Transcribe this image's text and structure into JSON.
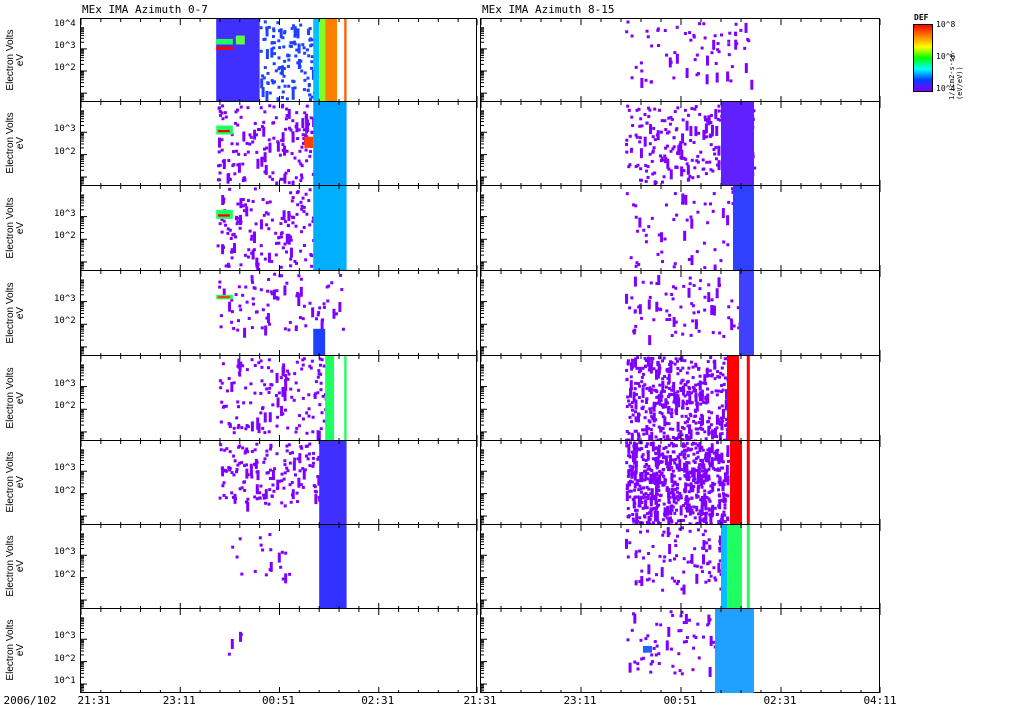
{
  "chart_data": {
    "type": "heatmap",
    "titles": [
      "MEx IMA Azimuth 0-7",
      "MEx IMA Azimuth 8-15"
    ],
    "date_label": "2006/102",
    "xticks": [
      "21:31",
      "23:11",
      "00:51",
      "02:31",
      "04:11"
    ],
    "xrange_hours": [
      0,
      6.667
    ],
    "ylabel": "Electron Volts",
    "yunit": "eV",
    "yrange_log10": [
      0.6,
      4.35
    ],
    "colorbar": {
      "label": "DEF",
      "unit": "1/(cm2-s-sr-(eV/eV))",
      "ticks": [
        "10^8",
        "10^6",
        "10^4"
      ]
    },
    "panels": [
      {
        "yticks": [
          "10^4",
          "10^3",
          "10^2"
        ],
        "left": [
          {
            "k": "fill",
            "t": [
              2.27,
              3.0
            ],
            "e": [
              0.6,
              4.35
            ],
            "c": "#4030ff"
          },
          {
            "k": "fill",
            "t": [
              2.27,
              2.55
            ],
            "e": [
              3.2,
              3.45
            ],
            "c": "#20ff60"
          },
          {
            "k": "fill",
            "t": [
              2.27,
              2.55
            ],
            "e": [
              2.95,
              3.1
            ],
            "c": "#ff0000"
          },
          {
            "k": "fill",
            "t": [
              2.6,
              2.75
            ],
            "e": [
              3.2,
              3.6
            ],
            "c": "#60ff40"
          },
          {
            "k": "dots",
            "t": [
              3.0,
              3.9
            ],
            "e": [
              0.8,
              4.3
            ],
            "n": 120,
            "c": "#2040ff"
          },
          {
            "k": "fill",
            "t": [
              3.9,
              4.0
            ],
            "e": [
              0.6,
              4.35
            ],
            "c": "#00c0ff"
          },
          {
            "k": "fill",
            "t": [
              4.0,
              4.1
            ],
            "e": [
              0.6,
              4.35
            ],
            "c": "#80ff20"
          },
          {
            "k": "fill",
            "t": [
              4.1,
              4.3
            ],
            "e": [
              0.6,
              4.35
            ],
            "c": "#ff8000"
          },
          {
            "k": "fill",
            "t": [
              4.42,
              4.46
            ],
            "e": [
              0.6,
              4.35
            ],
            "c": "#ff6000"
          }
        ],
        "right": [
          {
            "k": "dots",
            "t": [
              2.4,
              4.5
            ],
            "e": [
              1.5,
              4.3
            ],
            "n": 70,
            "c": "#7f00ff"
          }
        ]
      },
      {
        "yticks": [
          "10^3",
          "10^2"
        ],
        "left": [
          {
            "k": "dots",
            "t": [
              2.27,
              4.4
            ],
            "e": [
              0.8,
              4.3
            ],
            "n": 220,
            "c": "#7f00ff"
          },
          {
            "k": "fill",
            "t": [
              2.27,
              2.55
            ],
            "e": [
              2.9,
              3.3
            ],
            "c": "#20ff60"
          },
          {
            "k": "fill",
            "t": [
              2.3,
              2.5
            ],
            "e": [
              3.0,
              3.1
            ],
            "c": "#ff0000"
          },
          {
            "k": "fill",
            "t": [
              3.75,
              3.9
            ],
            "e": [
              2.3,
              2.8
            ],
            "c": "#ff4000"
          },
          {
            "k": "fill",
            "t": [
              3.9,
              4.46
            ],
            "e": [
              0.6,
              4.35
            ],
            "c": "#00a0ff"
          }
        ],
        "right": [
          {
            "k": "dots",
            "t": [
              2.4,
              4.55
            ],
            "e": [
              0.8,
              4.3
            ],
            "n": 260,
            "c": "#7f00ff"
          },
          {
            "k": "fill",
            "t": [
              4.0,
              4.55
            ],
            "e": [
              0.6,
              4.35
            ],
            "c": "#6020ff"
          }
        ]
      },
      {
        "yticks": [
          "10^3",
          "10^2"
        ],
        "left": [
          {
            "k": "dots",
            "t": [
              2.27,
              4.4
            ],
            "e": [
              0.8,
              4.3
            ],
            "n": 180,
            "c": "#7f00ff"
          },
          {
            "k": "fill",
            "t": [
              2.27,
              2.55
            ],
            "e": [
              2.9,
              3.3
            ],
            "c": "#20ff60"
          },
          {
            "k": "fill",
            "t": [
              2.3,
              2.5
            ],
            "e": [
              3.0,
              3.1
            ],
            "c": "#ff0000"
          },
          {
            "k": "fill",
            "t": [
              3.9,
              4.46
            ],
            "e": [
              0.6,
              4.35
            ],
            "c": "#00b0ff"
          }
        ],
        "right": [
          {
            "k": "dots",
            "t": [
              2.4,
              4.3
            ],
            "e": [
              0.8,
              4.3
            ],
            "n": 60,
            "c": "#7f00ff"
          },
          {
            "k": "fill",
            "t": [
              4.2,
              4.55
            ],
            "e": [
              0.6,
              4.35
            ],
            "c": "#3040ff"
          }
        ]
      },
      {
        "yticks": [
          "10^3",
          "10^2"
        ],
        "left": [
          {
            "k": "dots",
            "t": [
              2.27,
              4.4
            ],
            "e": [
              1.8,
              4.3
            ],
            "n": 90,
            "c": "#7f00ff"
          },
          {
            "k": "fill",
            "t": [
              2.27,
              2.55
            ],
            "e": [
              3.1,
              3.3
            ],
            "c": "#20ff60"
          },
          {
            "k": "fill",
            "t": [
              2.3,
              2.5
            ],
            "e": [
              3.15,
              3.25
            ],
            "c": "#ff4000"
          },
          {
            "k": "fill",
            "t": [
              3.9,
              4.1
            ],
            "e": [
              0.6,
              1.8
            ],
            "c": "#2040ff"
          }
        ],
        "right": [
          {
            "k": "dots",
            "t": [
              2.4,
              4.4
            ],
            "e": [
              1.5,
              4.3
            ],
            "n": 80,
            "c": "#7f00ff"
          },
          {
            "k": "fill",
            "t": [
              4.3,
              4.55
            ],
            "e": [
              0.6,
              4.35
            ],
            "c": "#4040ff"
          }
        ]
      },
      {
        "yticks": [
          "10^3",
          "10^2"
        ],
        "left": [
          {
            "k": "dots",
            "t": [
              2.27,
              4.2
            ],
            "e": [
              1.0,
              4.3
            ],
            "n": 150,
            "c": "#7f00ff"
          },
          {
            "k": "fill",
            "t": [
              4.1,
              4.25
            ],
            "e": [
              0.6,
              4.35
            ],
            "c": "#20ff60"
          },
          {
            "k": "fill",
            "t": [
              4.42,
              4.46
            ],
            "e": [
              0.6,
              4.35
            ],
            "c": "#20ff60"
          }
        ],
        "right": [
          {
            "k": "dots",
            "t": [
              2.4,
              4.1
            ],
            "e": [
              0.6,
              4.35
            ],
            "n": 450,
            "c": "#7f00ff"
          },
          {
            "k": "fill",
            "t": [
              4.1,
              4.3
            ],
            "e": [
              0.6,
              4.35
            ],
            "c": "#ff0000"
          },
          {
            "k": "fill",
            "t": [
              4.43,
              4.48
            ],
            "e": [
              0.6,
              4.35
            ],
            "c": "#ff0000"
          }
        ]
      },
      {
        "yticks": [
          "10^3",
          "10^2"
        ],
        "left": [
          {
            "k": "dots",
            "t": [
              2.27,
              4.0
            ],
            "e": [
              1.5,
              4.3
            ],
            "n": 160,
            "c": "#7f00ff"
          },
          {
            "k": "fill",
            "t": [
              4.0,
              4.46
            ],
            "e": [
              0.6,
              4.35
            ],
            "c": "#4030ff"
          }
        ],
        "right": [
          {
            "k": "dots",
            "t": [
              2.4,
              4.1
            ],
            "e": [
              0.6,
              4.35
            ],
            "n": 600,
            "c": "#7f00ff"
          },
          {
            "k": "fill",
            "t": [
              4.15,
              4.35
            ],
            "e": [
              0.6,
              4.35
            ],
            "c": "#ff0000"
          },
          {
            "k": "fill",
            "t": [
              4.43,
              4.48
            ],
            "e": [
              0.6,
              4.35
            ],
            "c": "#ff0000"
          }
        ]
      },
      {
        "yticks": [
          "10^3",
          "10^2"
        ],
        "left": [
          {
            "k": "dots",
            "t": [
              2.5,
              3.5
            ],
            "e": [
              2.0,
              4.0
            ],
            "n": 20,
            "c": "#7f00ff"
          },
          {
            "k": "fill",
            "t": [
              4.0,
              4.46
            ],
            "e": [
              0.6,
              4.35
            ],
            "c": "#3030ff"
          }
        ],
        "right": [
          {
            "k": "dots",
            "t": [
              2.4,
              4.0
            ],
            "e": [
              1.5,
              4.3
            ],
            "n": 90,
            "c": "#7f00ff"
          },
          {
            "k": "fill",
            "t": [
              4.0,
              4.1
            ],
            "e": [
              0.6,
              4.35
            ],
            "c": "#00c0ff"
          },
          {
            "k": "fill",
            "t": [
              4.1,
              4.35
            ],
            "e": [
              0.6,
              4.35
            ],
            "c": "#20ff60"
          },
          {
            "k": "fill",
            "t": [
              4.43,
              4.48
            ],
            "e": [
              0.6,
              4.35
            ],
            "c": "#20ff60"
          }
        ]
      },
      {
        "yticks": [
          "10^3",
          "10^2",
          "10^1"
        ],
        "left": [
          {
            "k": "dots",
            "t": [
              2.3,
              2.7
            ],
            "e": [
              2.4,
              3.4
            ],
            "n": 4,
            "c": "#7f00ff"
          }
        ],
        "right": [
          {
            "k": "dots",
            "t": [
              2.4,
              4.0
            ],
            "e": [
              1.5,
              4.3
            ],
            "n": 60,
            "c": "#7f00ff"
          },
          {
            "k": "fill",
            "t": [
              2.7,
              2.85
            ],
            "e": [
              2.4,
              2.7
            ],
            "c": "#2060ff"
          },
          {
            "k": "fill",
            "t": [
              3.9,
              4.55
            ],
            "e": [
              0.6,
              4.35
            ],
            "c": "#20a0ff"
          }
        ]
      }
    ]
  }
}
